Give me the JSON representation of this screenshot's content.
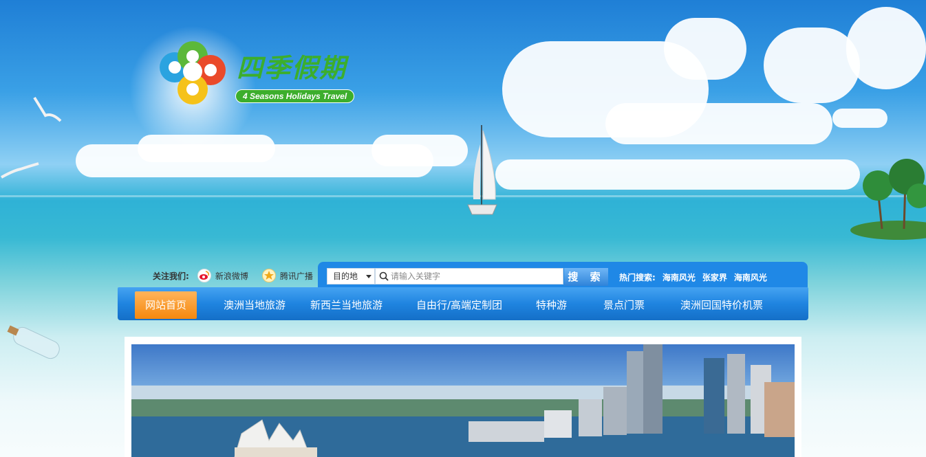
{
  "logo": {
    "cn_name": "四季假期",
    "en_name": "4 Seasons Holidays Travel"
  },
  "follow": {
    "label": "关注我们:",
    "items": [
      {
        "label": "新浪微博",
        "icon": "weibo-icon"
      },
      {
        "label": "腾讯广播",
        "icon": "tencent-icon"
      }
    ]
  },
  "search": {
    "destination": "目的地",
    "placeholder": "请输入关键字",
    "button": "搜 索",
    "hot_label": "热门搜索:",
    "hot_items": [
      "海南风光",
      "张家界",
      "海南风光"
    ]
  },
  "nav": {
    "items": [
      "网站首页",
      "澳洲当地旅游",
      "新西兰当地旅游",
      "自由行/高端定制团",
      "特种游",
      "景点门票",
      "澳洲回国特价机票"
    ],
    "active_index": 0
  },
  "colors": {
    "nav_blue": "#1f84e0",
    "active_orange": "#f5880e",
    "logo_green": "#3cae2c"
  }
}
